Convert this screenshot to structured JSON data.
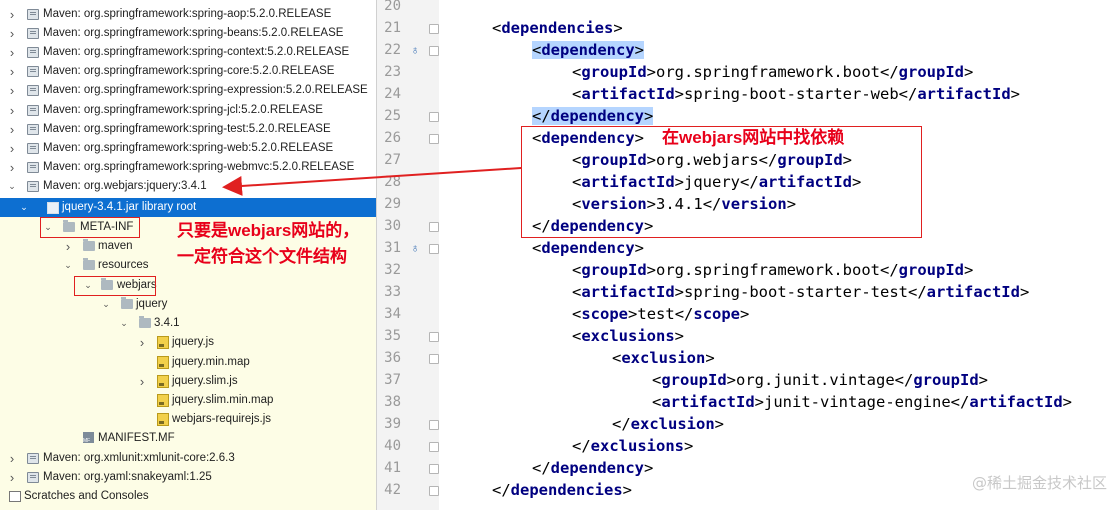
{
  "tree": {
    "items": [
      {
        "label": "Maven: org.springframework:spring-aop:5.2.0.RELEASE",
        "arrow": "›",
        "icon": "library-icon"
      },
      {
        "label": "Maven: org.springframework:spring-beans:5.2.0.RELEASE",
        "arrow": "›",
        "icon": "library-icon"
      },
      {
        "label": "Maven: org.springframework:spring-context:5.2.0.RELEASE",
        "arrow": "›",
        "icon": "library-icon"
      },
      {
        "label": "Maven: org.springframework:spring-core:5.2.0.RELEASE",
        "arrow": "›",
        "icon": "library-icon"
      },
      {
        "label": "Maven: org.springframework:spring-expression:5.2.0.RELEASE",
        "arrow": "›",
        "icon": "library-icon"
      },
      {
        "label": "Maven: org.springframework:spring-jcl:5.2.0.RELEASE",
        "arrow": "›",
        "icon": "library-icon"
      },
      {
        "label": "Maven: org.springframework:spring-test:5.2.0.RELEASE",
        "arrow": "›",
        "icon": "library-icon"
      },
      {
        "label": "Maven: org.springframework:spring-web:5.2.0.RELEASE",
        "arrow": "›",
        "icon": "library-icon"
      },
      {
        "label": "Maven: org.springframework:spring-webmvc:5.2.0.RELEASE",
        "arrow": "›",
        "icon": "library-icon"
      },
      {
        "label": "Maven: org.webjars:jquery:3.4.1",
        "arrow": "⌄",
        "icon": "library-icon"
      },
      {
        "label": "jquery-3.4.1.jar  library root",
        "arrow": "⌄",
        "icon": "jar-icon"
      },
      {
        "label": "META-INF",
        "arrow": "⌄",
        "icon": "folder-icon"
      },
      {
        "label": "maven",
        "arrow": "›",
        "icon": "folder-icon"
      },
      {
        "label": "resources",
        "arrow": "⌄",
        "icon": "folder-icon"
      },
      {
        "label": "webjars",
        "arrow": "⌄",
        "icon": "folder-icon"
      },
      {
        "label": "jquery",
        "arrow": "⌄",
        "icon": "folder-icon"
      },
      {
        "label": "3.4.1",
        "arrow": "⌄",
        "icon": "folder-icon"
      },
      {
        "label": "jquery.js",
        "arrow": "›",
        "icon": "js-file-icon"
      },
      {
        "label": "jquery.min.map",
        "arrow": "",
        "icon": "js-file-icon"
      },
      {
        "label": "jquery.slim.js",
        "arrow": "›",
        "icon": "js-file-icon"
      },
      {
        "label": "jquery.slim.min.map",
        "arrow": "",
        "icon": "js-file-icon"
      },
      {
        "label": "webjars-requirejs.js",
        "arrow": "",
        "icon": "js-file-icon"
      },
      {
        "label": "MANIFEST.MF",
        "arrow": "",
        "icon": "manifest-file-icon"
      },
      {
        "label": "Maven: org.xmlunit:xmlunit-core:2.6.3",
        "arrow": "›",
        "icon": "library-icon"
      },
      {
        "label": "Maven: org.yaml:snakeyaml:1.25",
        "arrow": "›",
        "icon": "library-icon"
      },
      {
        "label": "Scratches and Consoles",
        "arrow": "›",
        "icon": "scratches-icon"
      }
    ]
  },
  "annotations": {
    "left_text_line1": "只要是webjars网站的，",
    "left_text_line2": "一定符合这个文件结构",
    "right_text": "在webjars网站中找依赖"
  },
  "editor": {
    "line_numbers": [
      "20",
      "21",
      "22",
      "23",
      "24",
      "25",
      "26",
      "27",
      "28",
      "29",
      "30",
      "31",
      "32",
      "33",
      "34",
      "35",
      "36",
      "37",
      "38",
      "39",
      "40",
      "41",
      "42"
    ],
    "lines": [
      {
        "t1": "",
        "text": "",
        "t2": ""
      },
      {
        "t1": "dependencies",
        "text": "",
        "t2": "",
        "open": true
      },
      {
        "t1": "dependency",
        "text": "",
        "t2": "",
        "open": true,
        "hl": true
      },
      {
        "t1": "groupId",
        "text": "org.springframework.boot",
        "t2": "groupId"
      },
      {
        "t1": "artifactId",
        "text": "spring-boot-starter-web",
        "t2": "artifactId"
      },
      {
        "t1": "",
        "text": "",
        "t2": "dependency",
        "hl": true
      },
      {
        "t1": "dependency",
        "text": "",
        "t2": "",
        "open": true
      },
      {
        "t1": "groupId",
        "text": "org.webjars",
        "t2": "groupId"
      },
      {
        "t1": "artifactId",
        "text": "jquery",
        "t2": "artifactId"
      },
      {
        "t1": "version",
        "text": "3.4.1",
        "t2": "version"
      },
      {
        "t1": "",
        "text": "",
        "t2": "dependency"
      },
      {
        "t1": "dependency",
        "text": "",
        "t2": "",
        "open": true
      },
      {
        "t1": "groupId",
        "text": "org.springframework.boot",
        "t2": "groupId"
      },
      {
        "t1": "artifactId",
        "text": "spring-boot-starter-test",
        "t2": "artifactId"
      },
      {
        "t1": "scope",
        "text": "test",
        "t2": "scope"
      },
      {
        "t1": "exclusions",
        "text": "",
        "t2": "",
        "open": true
      },
      {
        "t1": "exclusion",
        "text": "",
        "t2": "",
        "open": true
      },
      {
        "t1": "groupId",
        "text": "org.junit.vintage",
        "t2": "groupId"
      },
      {
        "t1": "artifactId",
        "text": "junit-vintage-engine",
        "t2": "artifactId"
      },
      {
        "t1": "",
        "text": "",
        "t2": "exclusion"
      },
      {
        "t1": "",
        "text": "",
        "t2": "exclusions"
      },
      {
        "t1": "",
        "text": "",
        "t2": "dependency"
      },
      {
        "t1": "",
        "text": "",
        "t2": "dependencies"
      }
    ]
  },
  "watermark": "@稀土掘金技术社区",
  "colors": {
    "selection": "#0d6fd1",
    "annotation": "#e8001a",
    "tag": "#000080",
    "tag_highlight": "#b5d5ff"
  }
}
